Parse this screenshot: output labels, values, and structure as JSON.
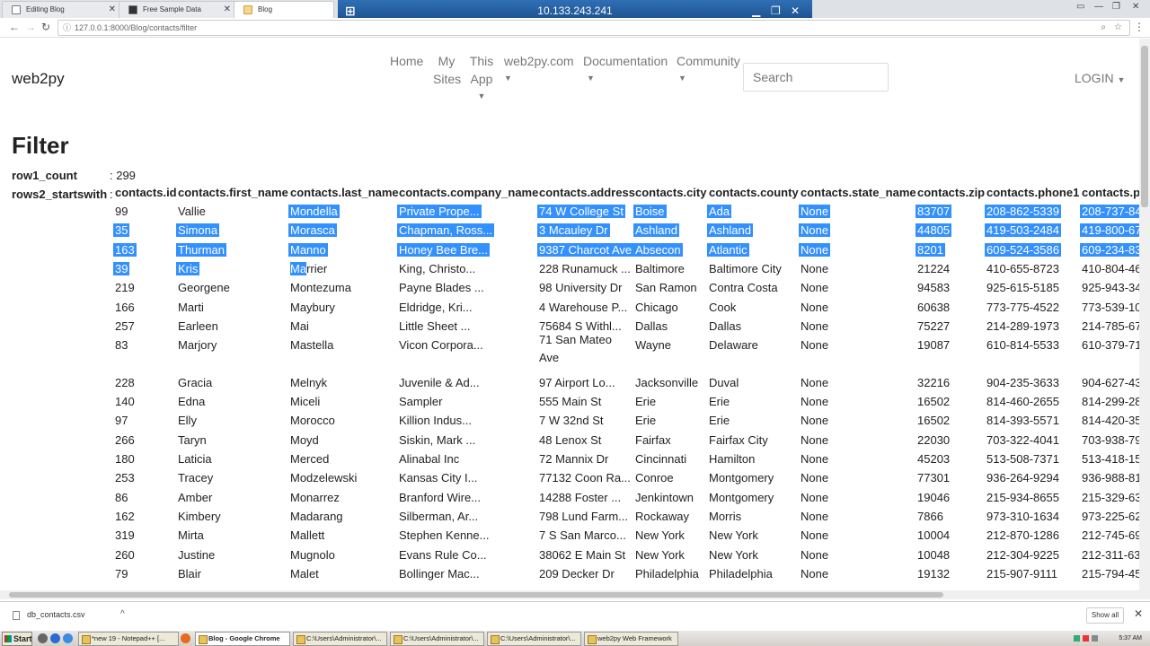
{
  "browser": {
    "tabs": [
      {
        "label": "Editing Blog"
      },
      {
        "label": "Free Sample Data"
      },
      {
        "label": "Blog"
      }
    ],
    "remote_title": "10.133.243.241",
    "url": "127.0.0.1:8000/Blog/contacts/filter"
  },
  "navbar": {
    "brand": "web2py",
    "items": [
      {
        "label": "Home",
        "dropdown": false
      },
      {
        "label": "My Sites",
        "dropdown": false
      },
      {
        "label": "This App",
        "dropdown": true
      },
      {
        "label": "web2py.com",
        "dropdown": true
      },
      {
        "label": "Documentation",
        "dropdown": true
      },
      {
        "label": "Community",
        "dropdown": true
      }
    ],
    "search_placeholder": "Search",
    "login_label": "LOGIN"
  },
  "page": {
    "title": "Filter",
    "row1_label": "row1_count",
    "row1_value": ": 299",
    "row2_label": "rows2_startswith",
    "row2_sep": ":"
  },
  "table": {
    "headers": [
      "contacts.id",
      "contacts.first_name",
      "contacts.last_name",
      "contacts.company_name",
      "contacts.address",
      "contacts.city",
      "contacts.county",
      "contacts.state_name",
      "contacts.zip",
      "contacts.phone1",
      "contacts.p"
    ],
    "rows": [
      [
        "99",
        "Vallie",
        "Mondella",
        "Private Prope...",
        "74 W College St",
        "Boise",
        "Ada",
        "None",
        "83707",
        "208-862-5339",
        "208-737-84"
      ],
      [
        "35",
        "Simona",
        "Morasca",
        "Chapman, Ross...",
        "3 Mcauley Dr",
        "Ashland",
        "Ashland",
        "None",
        "44805",
        "419-503-2484",
        "419-800-67"
      ],
      [
        "163",
        "Thurman",
        "Manno",
        "Honey Bee Bre...",
        "9387 Charcot Ave",
        "Absecon",
        "Atlantic",
        "None",
        "8201",
        "609-524-3586",
        "609-234-83"
      ],
      [
        "39",
        "Kris",
        "Marrier",
        "King, Christo...",
        "228 Runamuck ...",
        "Baltimore",
        "Baltimore City",
        "None",
        "21224",
        "410-655-8723",
        "410-804-46"
      ],
      [
        "219",
        "Georgene",
        "Montezuma",
        "Payne Blades ...",
        "98 University Dr",
        "San Ramon",
        "Contra Costa",
        "None",
        "94583",
        "925-615-5185",
        "925-943-34"
      ],
      [
        "166",
        "Marti",
        "Maybury",
        "Eldridge, Kri...",
        "4 Warehouse P...",
        "Chicago",
        "Cook",
        "None",
        "60638",
        "773-775-4522",
        "773-539-10"
      ],
      [
        "257",
        "Earleen",
        "Mai",
        "Little Sheet ...",
        "75684 S Withl...",
        "Dallas",
        "Dallas",
        "None",
        "75227",
        "214-289-1973",
        "214-785-67"
      ],
      [
        "83",
        "Marjory",
        "Mastella",
        "Vicon Corpora...",
        "71 San Mateo Ave",
        "Wayne",
        "Delaware",
        "None",
        "19087",
        "610-814-5533",
        "610-379-71"
      ],
      [
        "228",
        "Gracia",
        "Melnyk",
        "Juvenile & Ad...",
        "97 Airport Lo...",
        "Jacksonville",
        "Duval",
        "None",
        "32216",
        "904-235-3633",
        "904-627-43"
      ],
      [
        "140",
        "Edna",
        "Miceli",
        "Sampler",
        "555 Main St",
        "Erie",
        "Erie",
        "None",
        "16502",
        "814-460-2655",
        "814-299-28"
      ],
      [
        "97",
        "Elly",
        "Morocco",
        "Killion Indus...",
        "7 W 32nd St",
        "Erie",
        "Erie",
        "None",
        "16502",
        "814-393-5571",
        "814-420-35"
      ],
      [
        "266",
        "Taryn",
        "Moyd",
        "Siskin, Mark ...",
        "48 Lenox St",
        "Fairfax",
        "Fairfax City",
        "None",
        "22030",
        "703-322-4041",
        "703-938-79"
      ],
      [
        "180",
        "Laticia",
        "Merced",
        "Alinabal Inc",
        "72 Mannix Dr",
        "Cincinnati",
        "Hamilton",
        "None",
        "45203",
        "513-508-7371",
        "513-418-15"
      ],
      [
        "253",
        "Tracey",
        "Modzelewski",
        "Kansas City I...",
        "77132 Coon Ra...",
        "Conroe",
        "Montgomery",
        "None",
        "77301",
        "936-264-9294",
        "936-988-81"
      ],
      [
        "86",
        "Amber",
        "Monarrez",
        "Branford Wire...",
        "14288 Foster ...",
        "Jenkintown",
        "Montgomery",
        "None",
        "19046",
        "215-934-8655",
        "215-329-63"
      ],
      [
        "162",
        "Kimbery",
        "Madarang",
        "Silberman, Ar...",
        "798 Lund Farm...",
        "Rockaway",
        "Morris",
        "None",
        "7866",
        "973-310-1634",
        "973-225-62"
      ],
      [
        "319",
        "Mirta",
        "Mallett",
        "Stephen Kenne...",
        "7 S San Marco...",
        "New York",
        "New York",
        "None",
        "10004",
        "212-870-1286",
        "212-745-69"
      ],
      [
        "260",
        "Justine",
        "Mugnolo",
        "Evans Rule Co...",
        "38062 E Main St",
        "New York",
        "New York",
        "None",
        "10048",
        "212-304-9225",
        "212-311-63"
      ],
      [
        "79",
        "Blair",
        "Malet",
        "Bollinger Mac...",
        "209 Decker Dr",
        "Philadelphia",
        "Philadelphia",
        "None",
        "19132",
        "215-907-9111",
        "215-794-45"
      ]
    ]
  },
  "downloads": {
    "file": "db_contacts.csv",
    "show_all": "Show all"
  },
  "taskbar": {
    "start": "Start",
    "buttons": [
      {
        "label": "*new 19 - Notepad++ [..."
      },
      {
        "label": "Blog - Google Chrome"
      },
      {
        "label": "C:\\Users\\Administrator\\..."
      },
      {
        "label": "C:\\Users\\Administrator\\..."
      },
      {
        "label": "C:\\Users\\Administrator\\..."
      },
      {
        "label": "web2py Web Framework"
      }
    ],
    "clock": "5:37 AM"
  }
}
